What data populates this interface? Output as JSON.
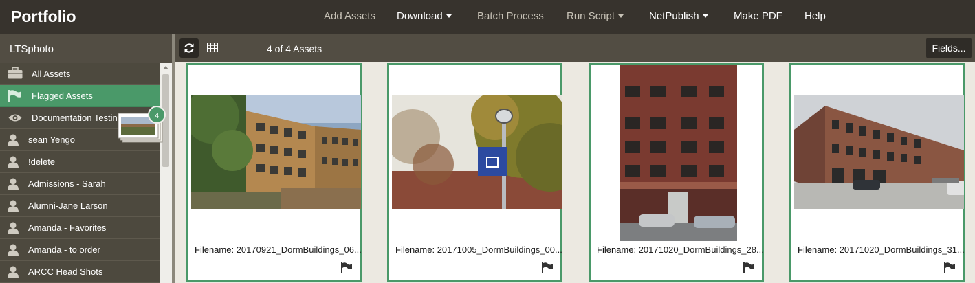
{
  "header": {
    "brand": "Portfolio",
    "nav": {
      "add_assets": "Add Assets",
      "download": "Download",
      "batch_process": "Batch Process",
      "run_script": "Run Script",
      "netpublish": "NetPublish",
      "make_pdf": "Make PDF",
      "help": "Help"
    }
  },
  "sidebar": {
    "library": "LTSphoto",
    "items": [
      {
        "label": "All Assets",
        "icon": "briefcase-icon"
      },
      {
        "label": "Flagged Assets",
        "icon": "flag-icon"
      },
      {
        "label": "Documentation Testing Gallery",
        "icon": "eye-icon"
      },
      {
        "label": "sean Yengo",
        "icon": "user-icon"
      },
      {
        "label": "!delete",
        "icon": "user-icon"
      },
      {
        "label": "Admissions - Sarah",
        "icon": "user-icon"
      },
      {
        "label": "Alumni-Jane Larson",
        "icon": "user-icon"
      },
      {
        "label": "Amanda - Favorites",
        "icon": "user-icon"
      },
      {
        "label": "Amanda - to order",
        "icon": "user-icon"
      },
      {
        "label": "ARCC Head Shots",
        "icon": "user-icon"
      }
    ],
    "drag_badge": "4"
  },
  "toolbar": {
    "asset_count": "4 of 4 Assets",
    "fields_label": "Fields..."
  },
  "assets": [
    {
      "label": "Filename:",
      "filename": "20170921_DormBuildings_06..."
    },
    {
      "label": "Filename:",
      "filename": "20171005_DormBuildings_00..."
    },
    {
      "label": "Filename:",
      "filename": "20171020_DormBuildings_28..."
    },
    {
      "label": "Filename:",
      "filename": "20171020_DormBuildings_31..."
    }
  ],
  "colors": {
    "topbar": "#37332d",
    "sidebar": "#4d493e",
    "accent_green": "#4a9969",
    "content_bg": "#ece9e1"
  }
}
